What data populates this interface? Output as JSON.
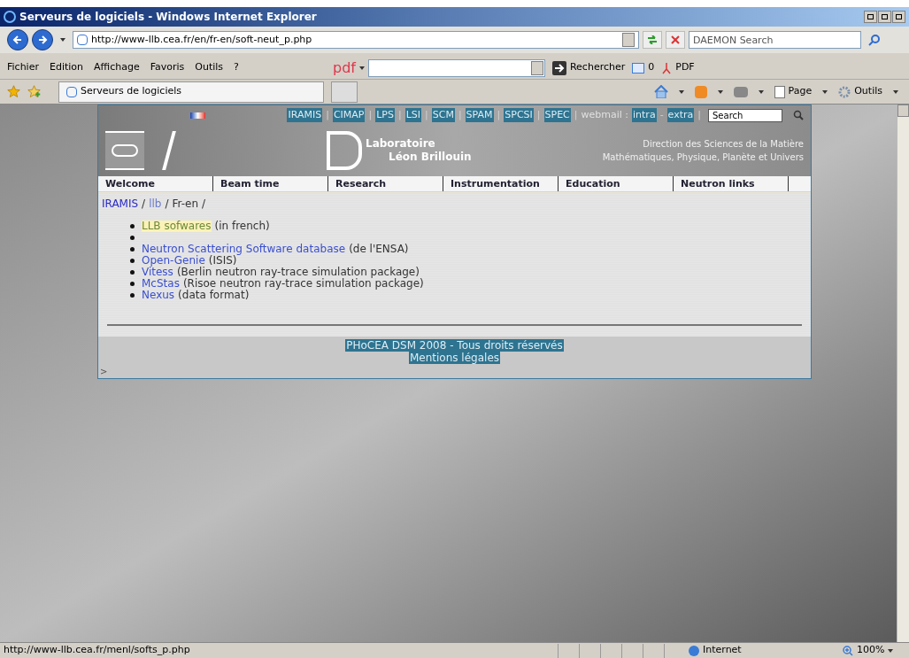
{
  "window": {
    "title": "Serveurs de logiciels - Windows Internet Explorer"
  },
  "address": {
    "url": "http://www-llb.cea.fr/en/fr-en/soft-neut_p.php"
  },
  "search": {
    "placeholder": "DAEMON Search"
  },
  "menu": [
    "Fichier",
    "Edition",
    "Affichage",
    "Favoris",
    "Outils",
    "?"
  ],
  "pdf_toolbar": {
    "logo": "pdf",
    "button": "Rechercher",
    "count": "0",
    "pdf": "PDF"
  },
  "tab": {
    "label": "Serveurs de logiciels",
    "selected": true
  },
  "command_bar": [
    "Page",
    "Outils"
  ],
  "page": {
    "top_links": [
      {
        "label": "IRAMIS",
        "separator": "|"
      },
      {
        "label": "CIMAP",
        "separator": "|"
      },
      {
        "label": "LPS",
        "separator": "|"
      },
      {
        "label": "LSI",
        "separator": "|"
      },
      {
        "label": "SCM",
        "separator": "|"
      },
      {
        "label": "SPAM",
        "separator": "|"
      },
      {
        "label": "SPCSI",
        "separator": "|"
      },
      {
        "label": "SPEC",
        "separator": "|"
      }
    ],
    "webmail": {
      "label": "webmail :",
      "links": [
        "intra",
        "extra"
      ],
      "dash": "-",
      "separator": "|"
    },
    "site_search": {
      "placeholder": "Search"
    },
    "lab_name": [
      "Laboratoire",
      "Léon Brillouin"
    ],
    "direction": [
      "Direction des Sciences de la Matière",
      "Mathématiques, Physique, Planète et Univers"
    ],
    "nav": [
      "Welcome",
      "Beam time",
      "Research",
      "Instrumentation",
      "Education",
      "Neutron links"
    ],
    "breadcrumb": [
      {
        "label": "IRAMIS",
        "kind": "link"
      },
      {
        "label": "llb",
        "kind": "visited"
      },
      {
        "label": "Fr-en",
        "kind": "plain"
      }
    ],
    "breadcrumb_separator": "/",
    "items": [
      {
        "kind": "entry",
        "link": "LLB sofwares",
        "note": "(in french)",
        "highlighted": true
      },
      {
        "kind": "empty"
      },
      {
        "kind": "entry",
        "link": "Neutron Scattering Software database",
        "note": "(de l'ENSA)",
        "highlighted": false
      },
      {
        "kind": "entry",
        "link": "Open-Genie",
        "note": "(ISIS)",
        "highlighted": false
      },
      {
        "kind": "entry",
        "link": "Vitess",
        "note": "(Berlin neutron ray-trace simulation package)",
        "highlighted": false
      },
      {
        "kind": "entry",
        "link": "McStas",
        "note": "(Risoe neutron ray-trace simulation package)",
        "highlighted": false
      },
      {
        "kind": "entry",
        "link": "Nexus",
        "note": "(data format)",
        "highlighted": false
      }
    ],
    "footer": [
      "PHoCEA DSM 2008 - Tous droits réservés",
      "Mentions légales"
    ],
    "marker": ">"
  },
  "status_bar": {
    "url": "http://www-llb.cea.fr/menl/softs_p.php",
    "zone": "Internet",
    "zoom": "100%"
  }
}
